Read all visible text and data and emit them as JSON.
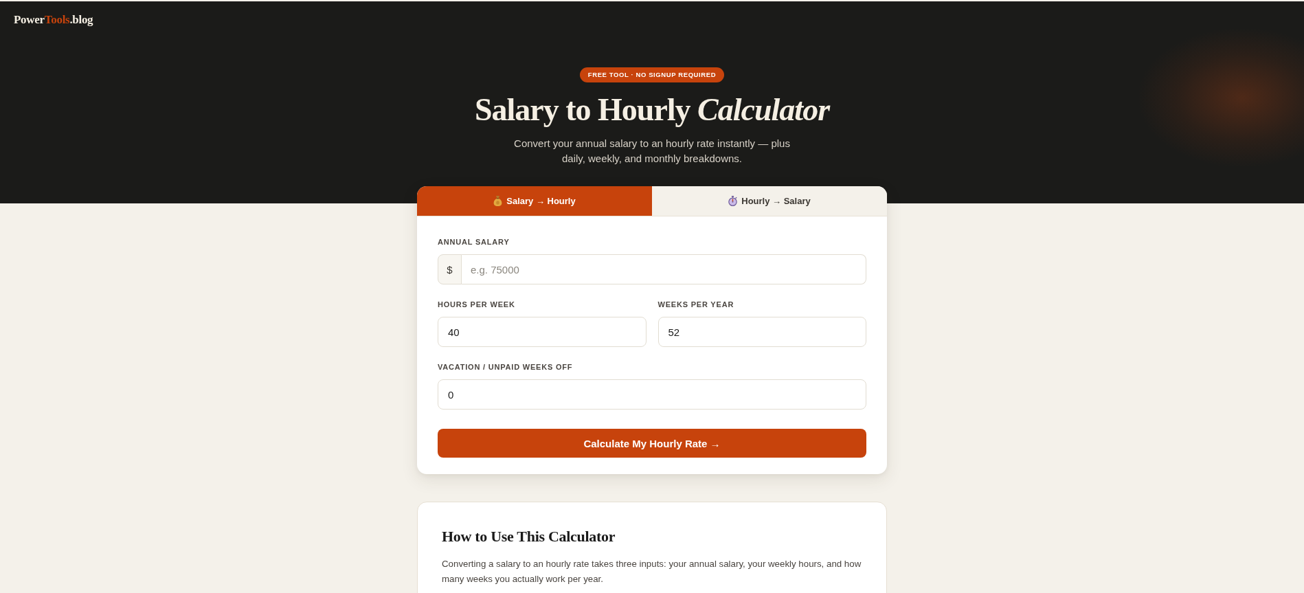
{
  "logo": {
    "text_before": "Power",
    "highlight": "Tools",
    "text_after": ".blog"
  },
  "hero": {
    "badge": "FREE TOOL · NO SIGNUP REQUIRED",
    "title": "Salary to Hourly *Calculator*",
    "subtitle": "Convert your annual salary to an hourly rate instantly — plus daily, weekly, and monthly breakdowns."
  },
  "calculator": {
    "tabs": [
      {
        "label": "Salary → Hourly",
        "selected": true
      },
      {
        "label": "Hourly → Salary",
        "selected": false
      }
    ],
    "field_rows": [
      [
        {
          "label": "ANNUAL SALARY",
          "prefix": "$",
          "placeholder": "e.g. 75000"
        }
      ],
      [
        {
          "label": "HOURS PER WEEK",
          "value": "40"
        },
        {
          "label": "WEEKS PER YEAR",
          "value": "52"
        }
      ],
      [
        {
          "label": "VACATION / UNPAID WEEKS OFF",
          "value": "0"
        }
      ]
    ],
    "button": "Calculate My Hourly Rate →"
  },
  "how_to": {
    "heading": "How to Use This Calculator",
    "paragraph": "Converting a salary to an hourly rate takes three inputs: your annual salary, your weekly hours, and how many weeks you actually work per year."
  }
}
